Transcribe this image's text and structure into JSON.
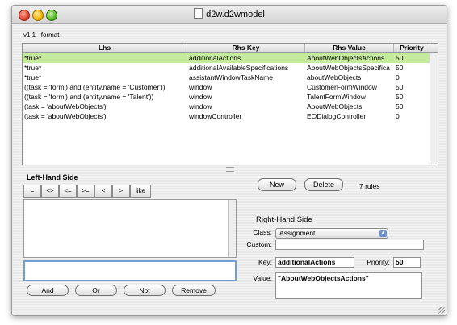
{
  "window": {
    "title": "d2w.d2wmodel"
  },
  "header": {
    "version": "v1.1",
    "format": "format"
  },
  "table": {
    "columns": [
      "Lhs",
      "Rhs Key",
      "Rhs Value",
      "Priority"
    ],
    "rows": [
      {
        "lhs": "*true*",
        "key": "additionalActions",
        "value": "AboutWebObjectsActions",
        "priority": "50",
        "selected": true
      },
      {
        "lhs": "*true*",
        "key": "additionalAvailableSpecifications",
        "value": "AboutWebObjectsSpecifica",
        "priority": "50",
        "selected": false
      },
      {
        "lhs": "*true*",
        "key": "assistantWindowTaskName",
        "value": "aboutWebObjects",
        "priority": "0",
        "selected": false
      },
      {
        "lhs": "((task = 'form') and (entity.name = 'Customer'))",
        "key": "window",
        "value": "CustomerFormWindow",
        "priority": "50",
        "selected": false
      },
      {
        "lhs": "((task = 'form') and (entity.name = 'Talent'))",
        "key": "window",
        "value": "TalentFormWindow",
        "priority": "50",
        "selected": false
      },
      {
        "lhs": "(task = 'aboutWebObjects')",
        "key": "window",
        "value": "AboutWebObjects",
        "priority": "50",
        "selected": false
      },
      {
        "lhs": "(task = 'aboutWebObjects')",
        "key": "windowController",
        "value": "EODialogController",
        "priority": "0",
        "selected": false
      }
    ]
  },
  "lhs_panel": {
    "title": "Left-Hand Side",
    "operators": [
      "=",
      "<>",
      "<=",
      ">=",
      "<",
      ">",
      "like"
    ],
    "input_value": "",
    "buttons": {
      "and": "And",
      "or": "Or",
      "not": "Not",
      "remove": "Remove"
    }
  },
  "actions": {
    "new": "New",
    "delete": "Delete",
    "rules_count": "7 rules"
  },
  "rhs_panel": {
    "title": "Right-Hand Side",
    "class_label": "Class:",
    "class_value": "Assignment",
    "custom_label": "Custom:",
    "custom_value": "",
    "key_label": "Key:",
    "key_value": "additionalActions",
    "priority_label": "Priority:",
    "priority_value": "50",
    "value_label": "Value:",
    "value_value": "\"AboutWebObjectsActions\""
  },
  "colors": {
    "selection": "#c6ea9c",
    "focus_ring": "#6f9ed8"
  }
}
